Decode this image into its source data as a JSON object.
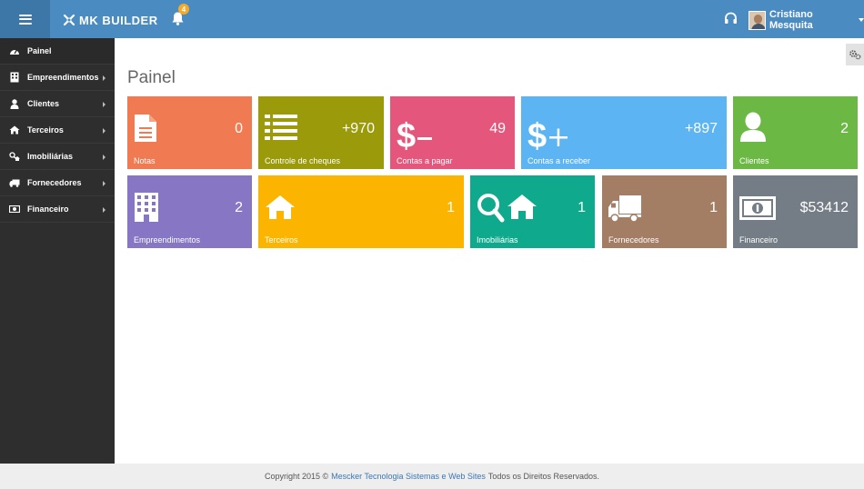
{
  "topbar": {
    "brand": "MK BUILDER",
    "notifications_count": "4",
    "user_name": "Cristiano Mesquita"
  },
  "sidebar": {
    "items": [
      {
        "label": "Painel",
        "icon": "dashboard-icon"
      },
      {
        "label": "Empreendimentos",
        "icon": "building-icon"
      },
      {
        "label": "Clientes",
        "icon": "user-icon"
      },
      {
        "label": "Terceiros",
        "icon": "home-icon"
      },
      {
        "label": "Imobiliárias",
        "icon": "search-home-icon"
      },
      {
        "label": "Fornecedores",
        "icon": "truck-icon"
      },
      {
        "label": "Financeiro",
        "icon": "money-icon"
      }
    ]
  },
  "main": {
    "title": "Painel",
    "tiles": [
      {
        "label": "Notas",
        "count": "0",
        "color": "#f07a52"
      },
      {
        "label": "Controle de cheques",
        "count": "+970",
        "color": "#9a9a0a"
      },
      {
        "label": "Contas a pagar",
        "count": "49",
        "color": "#e4567b"
      },
      {
        "label": "Contas a receber",
        "count": "+897",
        "color": "#5cb5f2"
      },
      {
        "label": "Clientes",
        "count": "2",
        "color": "#6bb844"
      },
      {
        "label": "Empreendimentos",
        "count": "2",
        "color": "#8676c4"
      },
      {
        "label": "Terceiros",
        "count": "1",
        "color": "#fbb500"
      },
      {
        "label": "Imobiliárias",
        "count": "1",
        "color": "#0fa98d"
      },
      {
        "label": "Fornecedores",
        "count": "1",
        "color": "#a37e65"
      },
      {
        "label": "Financeiro",
        "count": "$53412",
        "color": "#747c86"
      }
    ]
  },
  "footer": {
    "prefix": "Copyright 2015 ©",
    "link": "Mescker Tecnologia Sistemas e Web Sites",
    "suffix": "Todos os Direitos Reservados."
  }
}
